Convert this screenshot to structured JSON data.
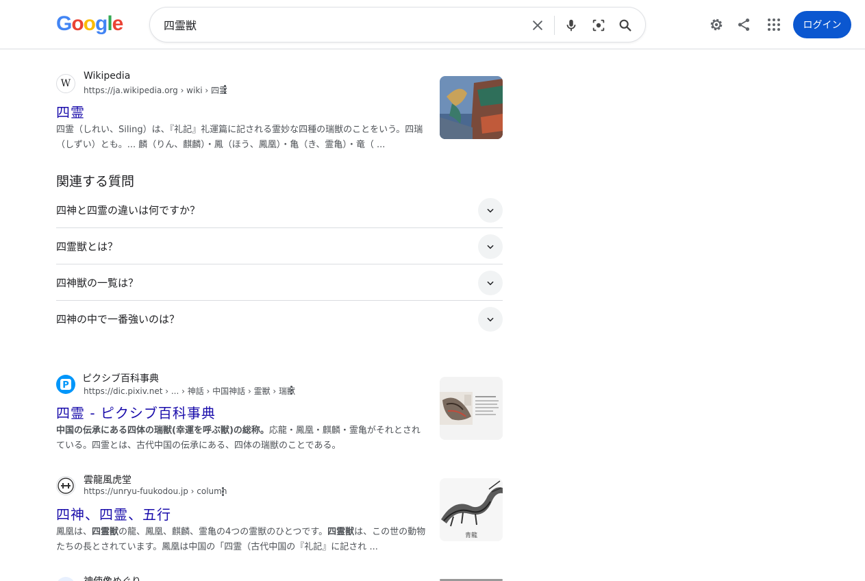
{
  "logo": "Google",
  "search": {
    "query": "四霊獣"
  },
  "header": {
    "login_label": "ログイン"
  },
  "results": [
    {
      "site_name": "Wikipedia",
      "url": "https://ja.wikipedia.org › wiki › 四霊",
      "title": "四霊",
      "snippet": "四霊（しれい、Siling）は、『礼記』礼運篇に記される霊妙な四種の瑞獣のことをいう。四瑞（しずい）とも。... 麟（りん、麒麟）・鳳（ほう、鳳凰）・亀（き、霊亀）・竜（ ..."
    },
    {
      "site_name": "ピクシブ百科事典",
      "url": "https://dic.pixiv.net › ... › 神話 › 中国神話 › 霊獣 › 瑞獣",
      "title": "四霊 - ピクシブ百科事典",
      "snippet_bold": "中国の伝承にある四体の瑞獣(幸運を呼ぶ獣)の総称。",
      "snippet": "応龍・鳳凰・麒麟・霊亀がそれとされている。四霊とは、古代中国の伝承にある、四体の瑞獣のことである。"
    },
    {
      "site_name": "雲龍風虎堂",
      "url": "https://unryu-fuukodou.jp › column",
      "title": "四神、四霊、五行",
      "snippet_a": "鳳凰は、",
      "snippet_b1": "四霊獣",
      "snippet_c": "の龍、鳳凰、麒麟、霊亀の4つの霊獣のひとつです。",
      "snippet_b2": "四霊獣",
      "snippet_d": "は、この世の動物たちの長とされています。鳳凰は中国の「四霊（古代中国の『礼記』に記され ...",
      "thumb_caption": "青龍"
    },
    {
      "site_name": "神使像めぐり"
    }
  ],
  "paa": {
    "title": "関連する質問",
    "questions": [
      "四神と四霊の違いは何ですか？",
      "四霊獣とは？",
      "四神獣の一覧は？",
      "四神の中で一番強いのは？"
    ]
  }
}
